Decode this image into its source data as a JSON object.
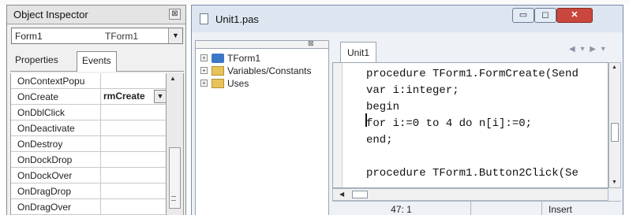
{
  "object_inspector": {
    "title": "Object Inspector",
    "close_glyph": "⊠",
    "component_name": "Form1",
    "component_type": "TForm1",
    "tabs": [
      "Properties",
      "Events"
    ],
    "active_tab": "Events",
    "events": [
      {
        "name": "OnContextPopu",
        "value": ""
      },
      {
        "name": "OnCreate",
        "value": "rmCreate"
      },
      {
        "name": "OnDblClick",
        "value": ""
      },
      {
        "name": "OnDeactivate",
        "value": ""
      },
      {
        "name": "OnDestroy",
        "value": ""
      },
      {
        "name": "OnDockDrop",
        "value": ""
      },
      {
        "name": "OnDockOver",
        "value": ""
      },
      {
        "name": "OnDragDrop",
        "value": ""
      },
      {
        "name": "OnDragOver",
        "value": ""
      }
    ]
  },
  "editor": {
    "title": "Unit1.pas",
    "window_buttons": {
      "minimize": "▭",
      "maximize": "◻",
      "close": "✕"
    },
    "tree_items": [
      {
        "label": "TForm1",
        "icon": "class-icon"
      },
      {
        "label": "Variables/Constants",
        "icon": "folder-icon"
      },
      {
        "label": "Uses",
        "icon": "folder-icon"
      }
    ],
    "tab": "Unit1",
    "code_lines": [
      "procedure TForm1.FormCreate(Send",
      "var i:integer;",
      "begin",
      "for i:=0 to 4 do n[i]:=0;",
      "end;",
      "",
      "procedure TForm1.Button2Click(Se"
    ],
    "status": {
      "position": "47:  1",
      "modified": "",
      "mode": "Insert"
    }
  }
}
